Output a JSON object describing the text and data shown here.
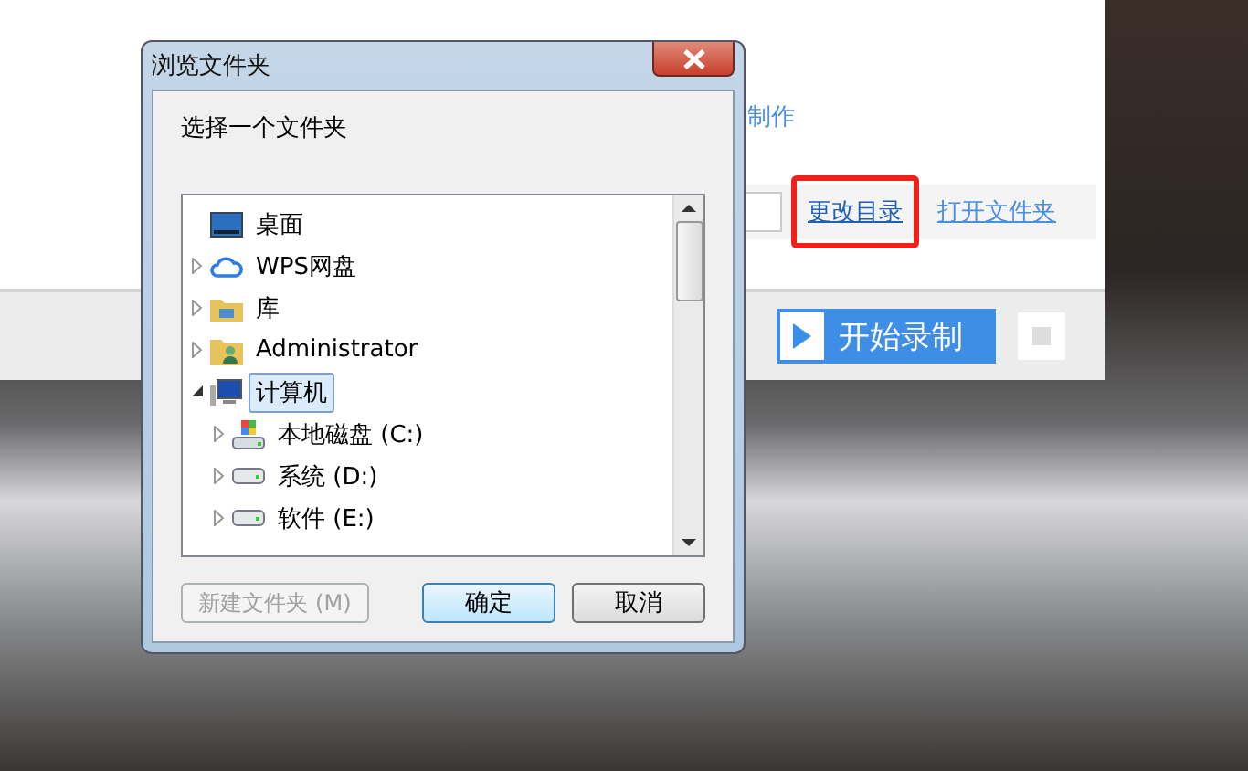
{
  "app": {
    "partial_link": "制作",
    "links": [
      {
        "label": "更改目录",
        "highlighted": true
      },
      {
        "label": "打开文件夹",
        "highlighted": false
      }
    ],
    "record_button": "开始录制"
  },
  "dialog": {
    "title": "浏览文件夹",
    "prompt": "选择一个文件夹",
    "tree": [
      {
        "label": "桌面",
        "kind": "desktop",
        "selected": false
      },
      {
        "label": "WPS网盘",
        "kind": "cloud",
        "expanded": false,
        "selected": false
      },
      {
        "label": "库",
        "kind": "library",
        "expanded": false,
        "selected": false
      },
      {
        "label": "Administrator",
        "kind": "user",
        "expanded": false,
        "selected": false
      },
      {
        "label": "计算机",
        "kind": "computer",
        "expanded": true,
        "selected": true,
        "children": [
          {
            "label": "本地磁盘 (C:)",
            "kind": "system-drive",
            "expanded": false,
            "selected": false
          },
          {
            "label": "系统 (D:)",
            "kind": "drive",
            "expanded": false,
            "selected": false
          },
          {
            "label": "软件 (E:)",
            "kind": "drive",
            "expanded": false,
            "selected": false
          }
        ]
      }
    ],
    "buttons": [
      {
        "label": "新建文件夹 (M)",
        "disabled": true,
        "default": false
      },
      {
        "label": "确定",
        "disabled": false,
        "default": true
      },
      {
        "label": "取消",
        "disabled": false,
        "default": false
      }
    ]
  }
}
